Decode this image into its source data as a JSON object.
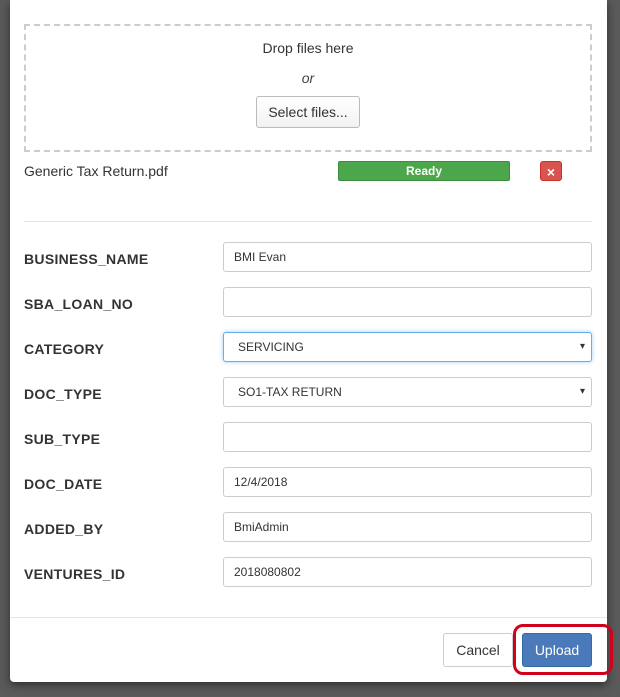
{
  "dropzone": {
    "drop_text": "Drop files here",
    "or_text": "or",
    "select_label": "Select files..."
  },
  "file": {
    "name": "Generic Tax Return.pdf",
    "status": "Ready",
    "status_color": "#4ca64c",
    "remove_icon": "×"
  },
  "form": {
    "fields": [
      {
        "label": "BUSINESS_NAME",
        "value": "BMI Evan"
      },
      {
        "label": "SBA_LOAN_NO",
        "value": ""
      },
      {
        "label": "CATEGORY",
        "value": "SERVICING"
      },
      {
        "label": "DOC_TYPE",
        "value": "SO1-TAX RETURN"
      },
      {
        "label": "SUB_TYPE",
        "value": ""
      },
      {
        "label": "DOC_DATE",
        "value": "12/4/2018"
      },
      {
        "label": "ADDED_BY",
        "value": "BmiAdmin"
      },
      {
        "label": "VENTURES_ID",
        "value": "2018080802"
      }
    ]
  },
  "footer": {
    "cancel_label": "Cancel",
    "upload_label": "Upload",
    "highlight_color": "#d0021b",
    "primary_color": "#4a7ab9"
  },
  "icons": {
    "select_arrow": "▾"
  }
}
